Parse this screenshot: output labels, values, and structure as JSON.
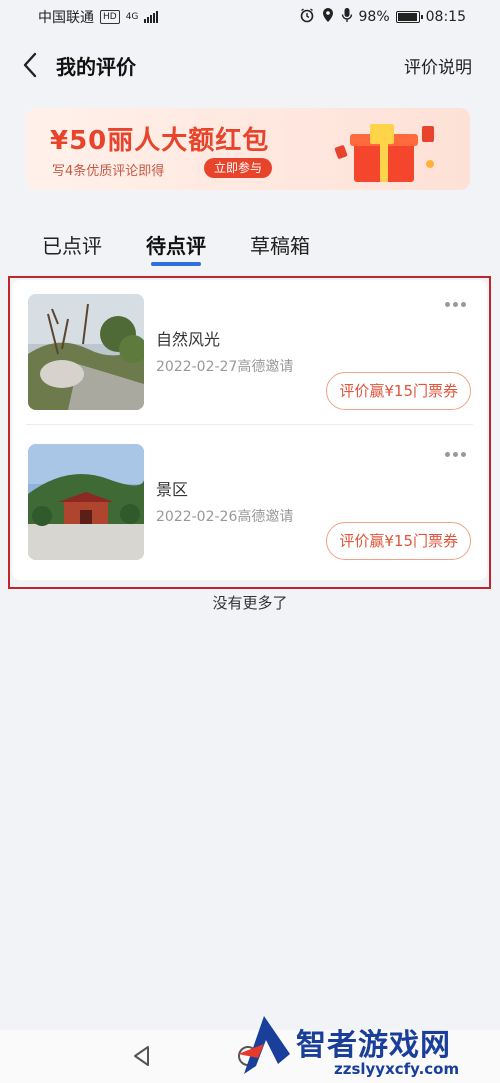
{
  "status_bar": {
    "carrier": "中国联通",
    "network_badge": "HD",
    "network_type": "4G",
    "battery": "98%",
    "battery_level": 0.98,
    "time": "08:15"
  },
  "header": {
    "title": "我的评价",
    "right_link": "评价说明"
  },
  "banner": {
    "title": "¥50丽人大额红包",
    "subtitle": "写4条优质评论即得",
    "button": "立即参与"
  },
  "tabs": [
    {
      "label": "已点评",
      "active": false
    },
    {
      "label": "待点评",
      "active": true
    },
    {
      "label": "草稿箱",
      "active": false
    }
  ],
  "items": [
    {
      "name": "自然风光",
      "date": "2022-02-27高德邀请",
      "button": "评价赢¥15门票券"
    },
    {
      "name": "景区",
      "date": "2022-02-26高德邀请",
      "button": "评价赢¥15门票券"
    }
  ],
  "footer_text": "没有更多了",
  "watermark": {
    "title": "智者游戏网",
    "url": "zzslyyxcfy.com"
  },
  "colors": {
    "accent_blue": "#2f6fe0",
    "accent_red": "#e8442c",
    "highlight_border": "#c0262d"
  }
}
